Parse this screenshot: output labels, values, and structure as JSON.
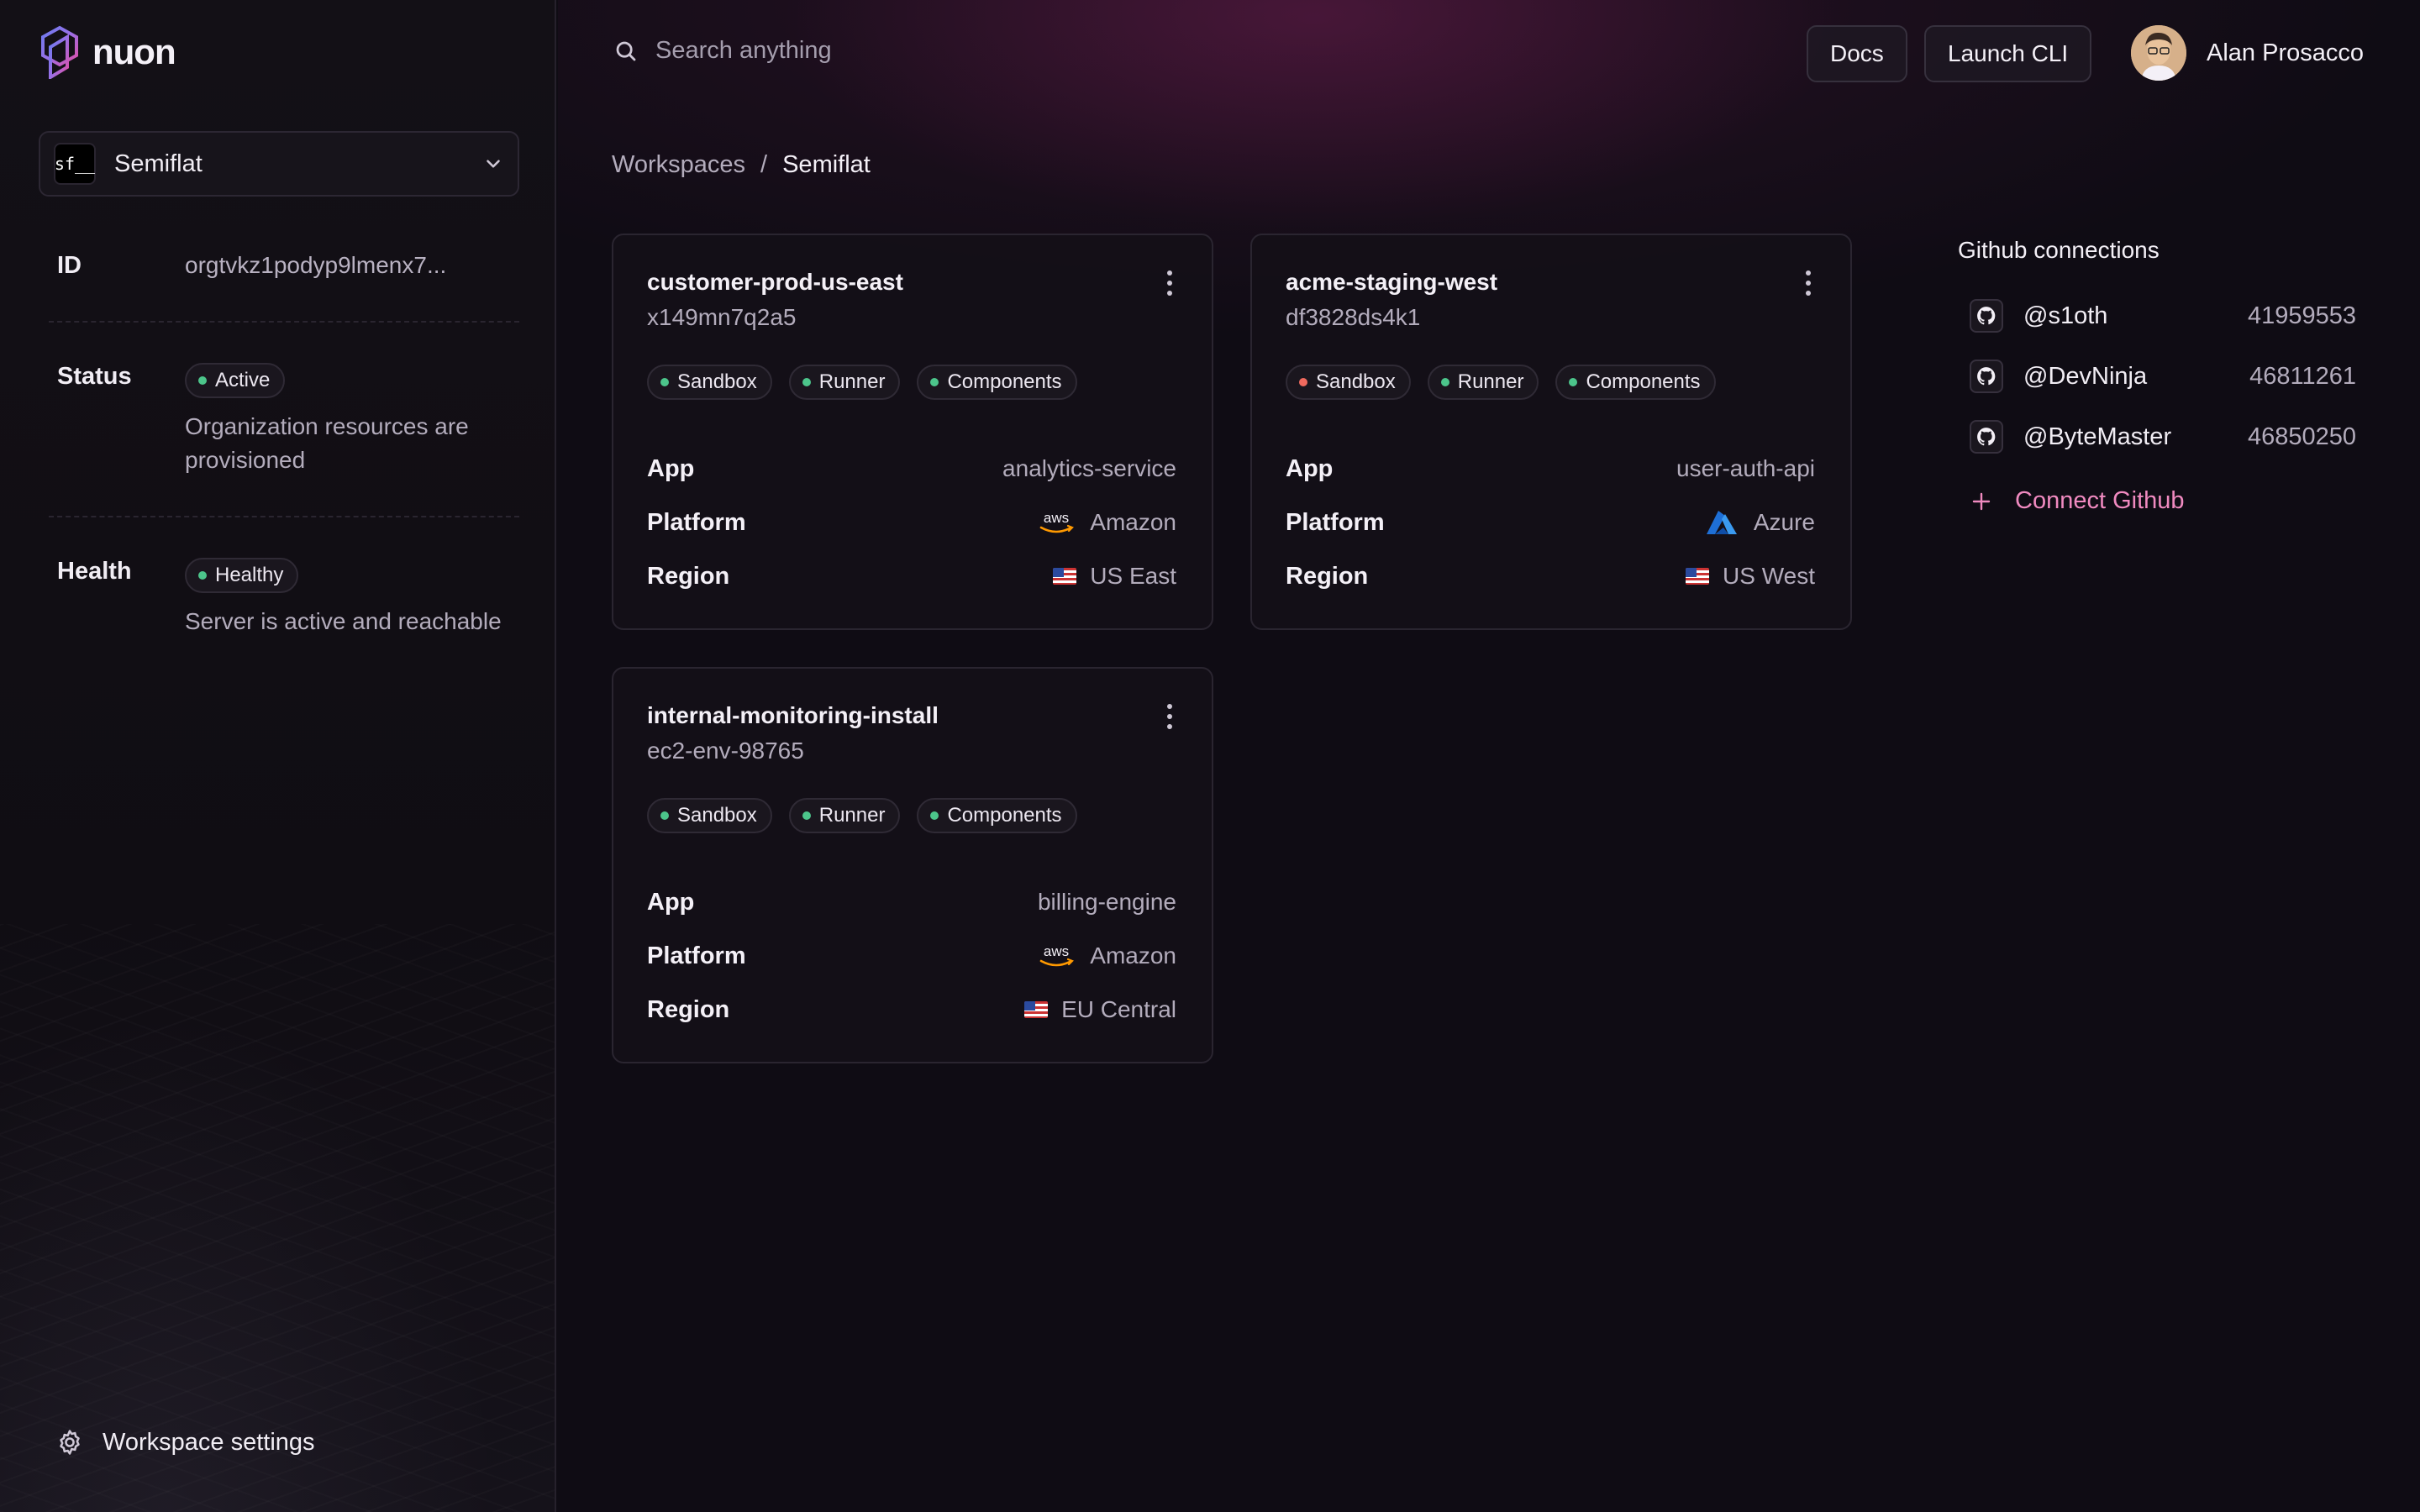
{
  "brand": {
    "name": "nuon"
  },
  "org": {
    "name": "Semiflat",
    "avatar_text": "sf__"
  },
  "info": {
    "id_label": "ID",
    "id_value": "orgtvkz1podyp9lmenx7...",
    "status_label": "Status",
    "status_badge": "Active",
    "status_desc": "Organization resources are provisioned",
    "health_label": "Health",
    "health_badge": "Healthy",
    "health_desc": "Server is active and reachable"
  },
  "sidebar_footer": {
    "settings_label": "Workspace settings"
  },
  "header": {
    "search_placeholder": "Search anything",
    "docs_label": "Docs",
    "cli_label": "Launch CLI",
    "user_name": "Alan Prosacco"
  },
  "breadcrumb": {
    "root": "Workspaces",
    "separator": "/",
    "current": "Semiflat"
  },
  "cards": [
    {
      "title": "customer-prod-us-east",
      "id": "x149mn7q2a5",
      "badges": [
        {
          "label": "Sandbox",
          "status": "green"
        },
        {
          "label": "Runner",
          "status": "green"
        },
        {
          "label": "Components",
          "status": "green"
        }
      ],
      "app_label": "App",
      "app": "analytics-service",
      "platform_label": "Platform",
      "platform": "Amazon",
      "platform_icon": "aws-icon",
      "region_label": "Region",
      "region": "US East",
      "region_icon": "us-flag-icon"
    },
    {
      "title": "acme-staging-west",
      "id": "df3828ds4k1",
      "badges": [
        {
          "label": "Sandbox",
          "status": "red"
        },
        {
          "label": "Runner",
          "status": "green"
        },
        {
          "label": "Components",
          "status": "green"
        }
      ],
      "app_label": "App",
      "app": "user-auth-api",
      "platform_label": "Platform",
      "platform": "Azure",
      "platform_icon": "azure-icon",
      "region_label": "Region",
      "region": "US West",
      "region_icon": "us-flag-icon"
    },
    {
      "title": "internal-monitoring-install",
      "id": "ec2-env-98765",
      "badges": [
        {
          "label": "Sandbox",
          "status": "green"
        },
        {
          "label": "Runner",
          "status": "green"
        },
        {
          "label": "Components",
          "status": "green"
        }
      ],
      "app_label": "App",
      "app": "billing-engine",
      "platform_label": "Platform",
      "platform": "Amazon",
      "platform_icon": "aws-icon",
      "region_label": "Region",
      "region": "EU Central",
      "region_icon": "us-flag-icon"
    }
  ],
  "github": {
    "title": "Github connections",
    "connections": [
      {
        "user": "@s1oth",
        "id": "41959553"
      },
      {
        "user": "@DevNinja",
        "id": "46811261"
      },
      {
        "user": "@ByteMaster",
        "id": "46850250"
      }
    ],
    "connect_label": "Connect Github"
  },
  "colors": {
    "accent": "#f08ac0",
    "ok": "#4cc58b",
    "warn": "#f06a5e",
    "background": "#0f0c14"
  }
}
